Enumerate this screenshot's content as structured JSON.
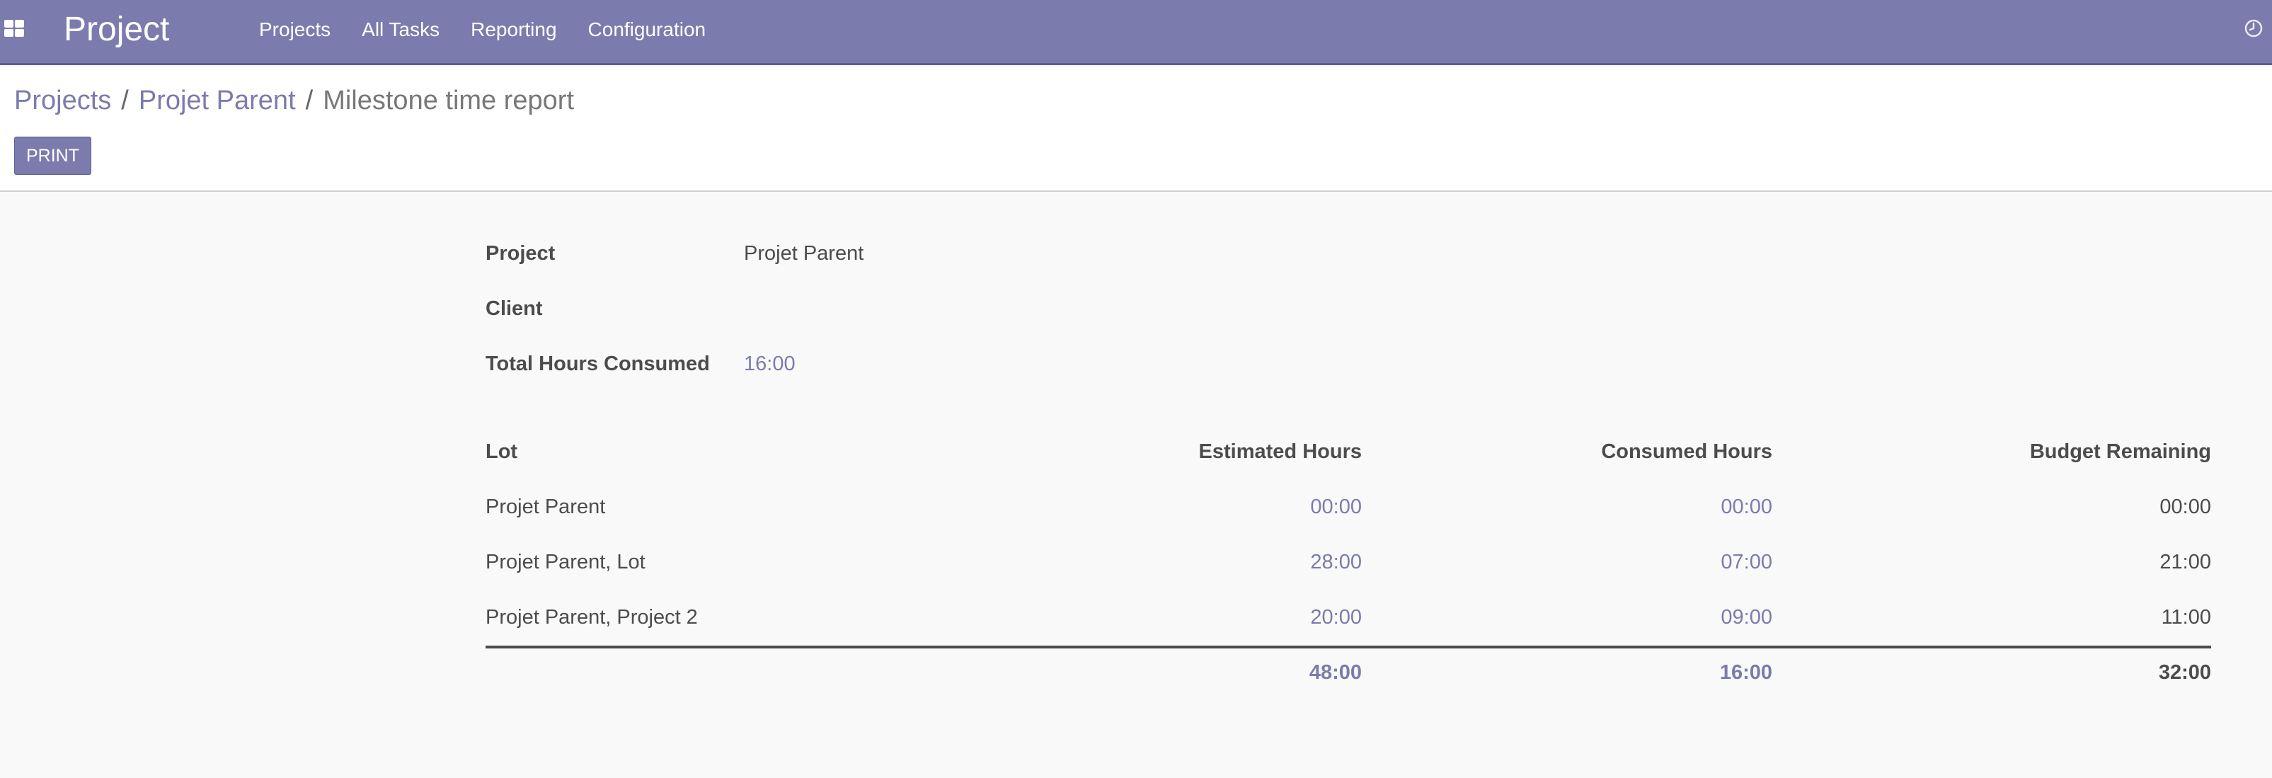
{
  "app": {
    "title": "Project",
    "menu": [
      "Projects",
      "All Tasks",
      "Reporting",
      "Configuration"
    ]
  },
  "breadcrumb": {
    "items": [
      "Projects",
      "Projet Parent"
    ],
    "current": "Milestone time report",
    "separator": "/"
  },
  "toolbar": {
    "print_label": "PRINT"
  },
  "report": {
    "fields": [
      {
        "label": "Project",
        "value": "Projet Parent"
      },
      {
        "label": "Client",
        "value": ""
      },
      {
        "label": "Total Hours Consumed",
        "value": "16:00"
      }
    ],
    "table": {
      "headers": [
        "Lot",
        "Estimated Hours",
        "Consumed Hours",
        "Budget Remaining"
      ],
      "rows": [
        {
          "lot": "Projet Parent",
          "estimated": "00:00",
          "consumed": "00:00",
          "remaining": "00:00"
        },
        {
          "lot": "Projet Parent, Lot",
          "estimated": "28:00",
          "consumed": "07:00",
          "remaining": "21:00"
        },
        {
          "lot": "Projet Parent, Project 2",
          "estimated": "20:00",
          "consumed": "09:00",
          "remaining": "11:00"
        }
      ],
      "totals": {
        "estimated": "48:00",
        "consumed": "16:00",
        "remaining": "32:00"
      }
    }
  },
  "icons": {
    "apps": "apps-grid-icon",
    "clock": "clock-icon"
  },
  "colors": {
    "brand": "#7c7bad",
    "text": "#4c4c4c",
    "background": "#f9f9f9"
  }
}
